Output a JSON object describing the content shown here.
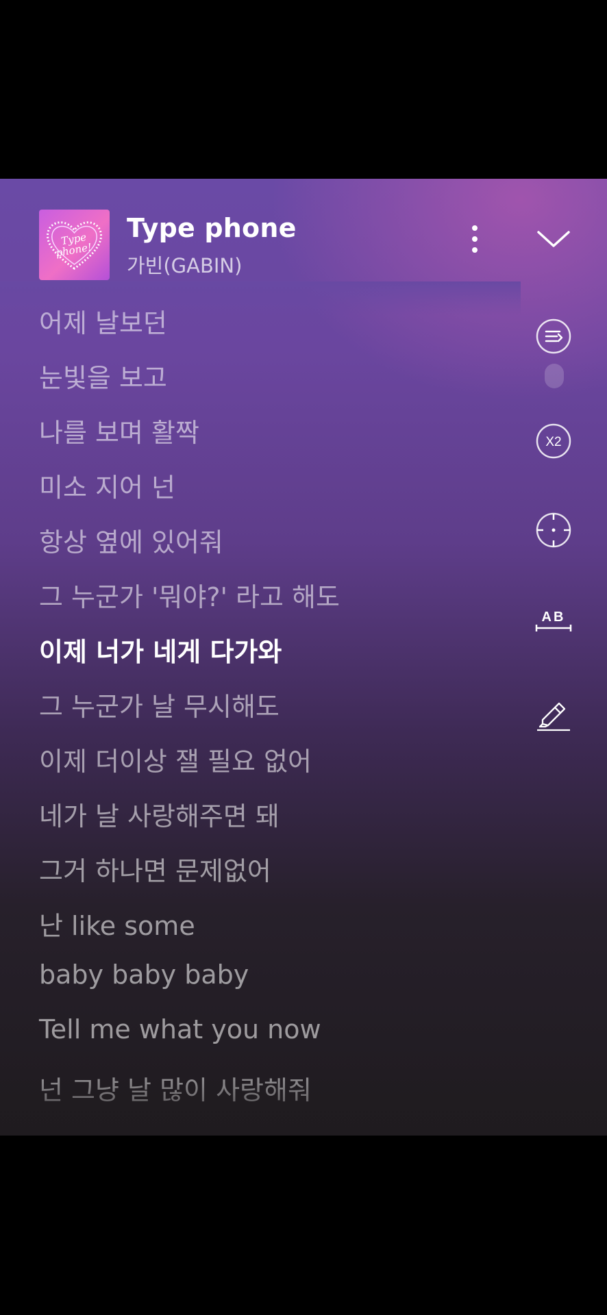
{
  "header": {
    "title": "Type phone",
    "artist": "가빈(GABIN)",
    "cover_text": "Type phone!",
    "more_icon": "more-vertical-icon",
    "collapse_icon": "chevron-down-icon"
  },
  "lyrics": {
    "active_index": 6,
    "lines": [
      "어제 날보던",
      "눈빛을 보고",
      "나를 보며 활짝",
      "미소 지어 넌",
      "항상 옆에 있어줘",
      "그 누군가 '뭐야?' 라고 해도",
      "이제 너가 네게 다가와",
      "그 누군가 날 무시해도",
      "이제 더이상 잴 필요 없어",
      "네가 날 사랑해주면 돼",
      "그거 하나면 문제없어",
      "난 like some",
      "baby baby baby",
      "Tell me what you now",
      "넌 그냥 날 많이 사랑해줘"
    ]
  },
  "tools": {
    "auto_scroll_icon": "auto-scroll-lyrics-icon",
    "speed_label": "X2",
    "locate_icon": "crosshair-icon",
    "ab_label": "AB",
    "highlight_icon": "highlighter-icon"
  },
  "colors": {
    "background_top": "#6a4aa6",
    "background_bottom": "#1f1b1f",
    "active_lyric": "#ffffff",
    "inactive_lyric": "#b7aec4"
  }
}
